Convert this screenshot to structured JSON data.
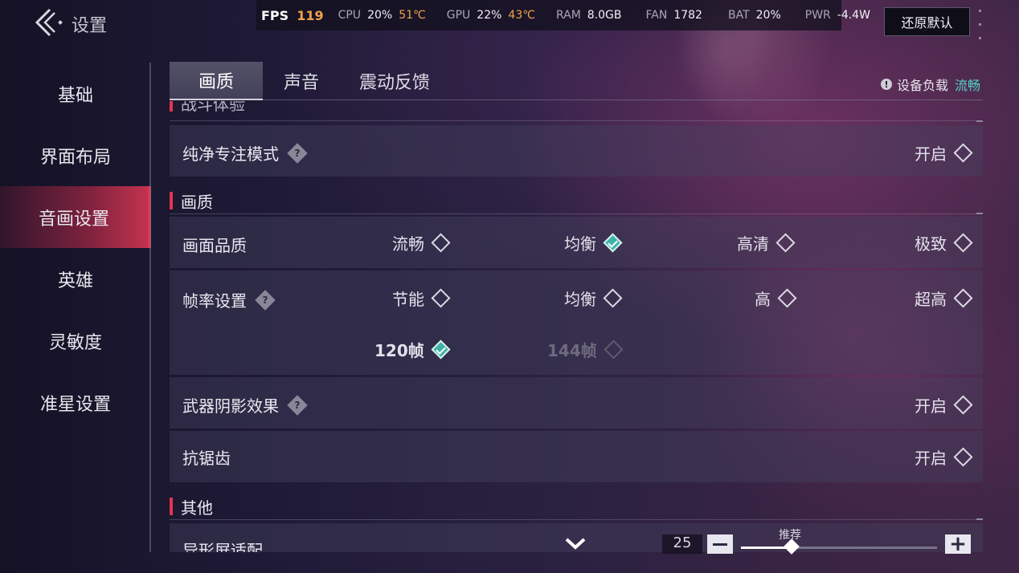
{
  "header": {
    "title": "设置",
    "reset_label": "还原默认"
  },
  "perf": {
    "fps_label": "FPS",
    "fps_value": "119",
    "cpu_label": "CPU",
    "cpu_value": "20%",
    "cpu_temp": "51℃",
    "gpu_label": "GPU",
    "gpu_value": "22%",
    "gpu_temp": "43℃",
    "ram_label": "RAM",
    "ram_value": "8.0GB",
    "fan_label": "FAN",
    "fan_value": "1782",
    "bat_label": "BAT",
    "bat_value": "20%",
    "pwr_label": "PWR",
    "pwr_value": "-4.4W"
  },
  "sidebar": {
    "items": [
      {
        "label": "基础"
      },
      {
        "label": "界面布局"
      },
      {
        "label": "音画设置",
        "active": true
      },
      {
        "label": "英雄"
      },
      {
        "label": "灵敏度"
      },
      {
        "label": "准星设置"
      }
    ]
  },
  "tabs": [
    {
      "label": "画质",
      "active": true
    },
    {
      "label": "声音"
    },
    {
      "label": "震动反馈"
    }
  ],
  "device_load": {
    "label": "设备负载",
    "status": "流畅",
    "info_glyph": "!"
  },
  "sections": {
    "battery_partial": "战斗体验",
    "quality": "画质",
    "other": "其他"
  },
  "rows": {
    "focus_mode": {
      "label": "纯净专注模式",
      "value": "开启"
    },
    "picture_quality": {
      "label": "画面品质",
      "options": [
        "流畅",
        "均衡",
        "高清",
        "极致"
      ],
      "selected": "均衡"
    },
    "frame_rate": {
      "label": "帧率设置",
      "options": [
        "节能",
        "均衡",
        "高",
        "超高"
      ],
      "extra_options": [
        "120帧",
        "144帧"
      ],
      "selected": "120帧",
      "disabled": "144帧"
    },
    "weapon_shadow": {
      "label": "武器阴影效果",
      "value": "开启"
    },
    "anti_alias": {
      "label": "抗锯齿",
      "value": "开启"
    },
    "notch": {
      "label": "异形屏适配"
    }
  },
  "help_glyph": "?",
  "slider": {
    "value": "25",
    "recommend_label": "推荐",
    "plus": "+",
    "fraction": 0.26
  },
  "colors": {
    "accent_red": "#e5334f",
    "accent_teal": "#3fb3a8",
    "status_green": "#52d1c0",
    "warm": "#f1a34a"
  }
}
